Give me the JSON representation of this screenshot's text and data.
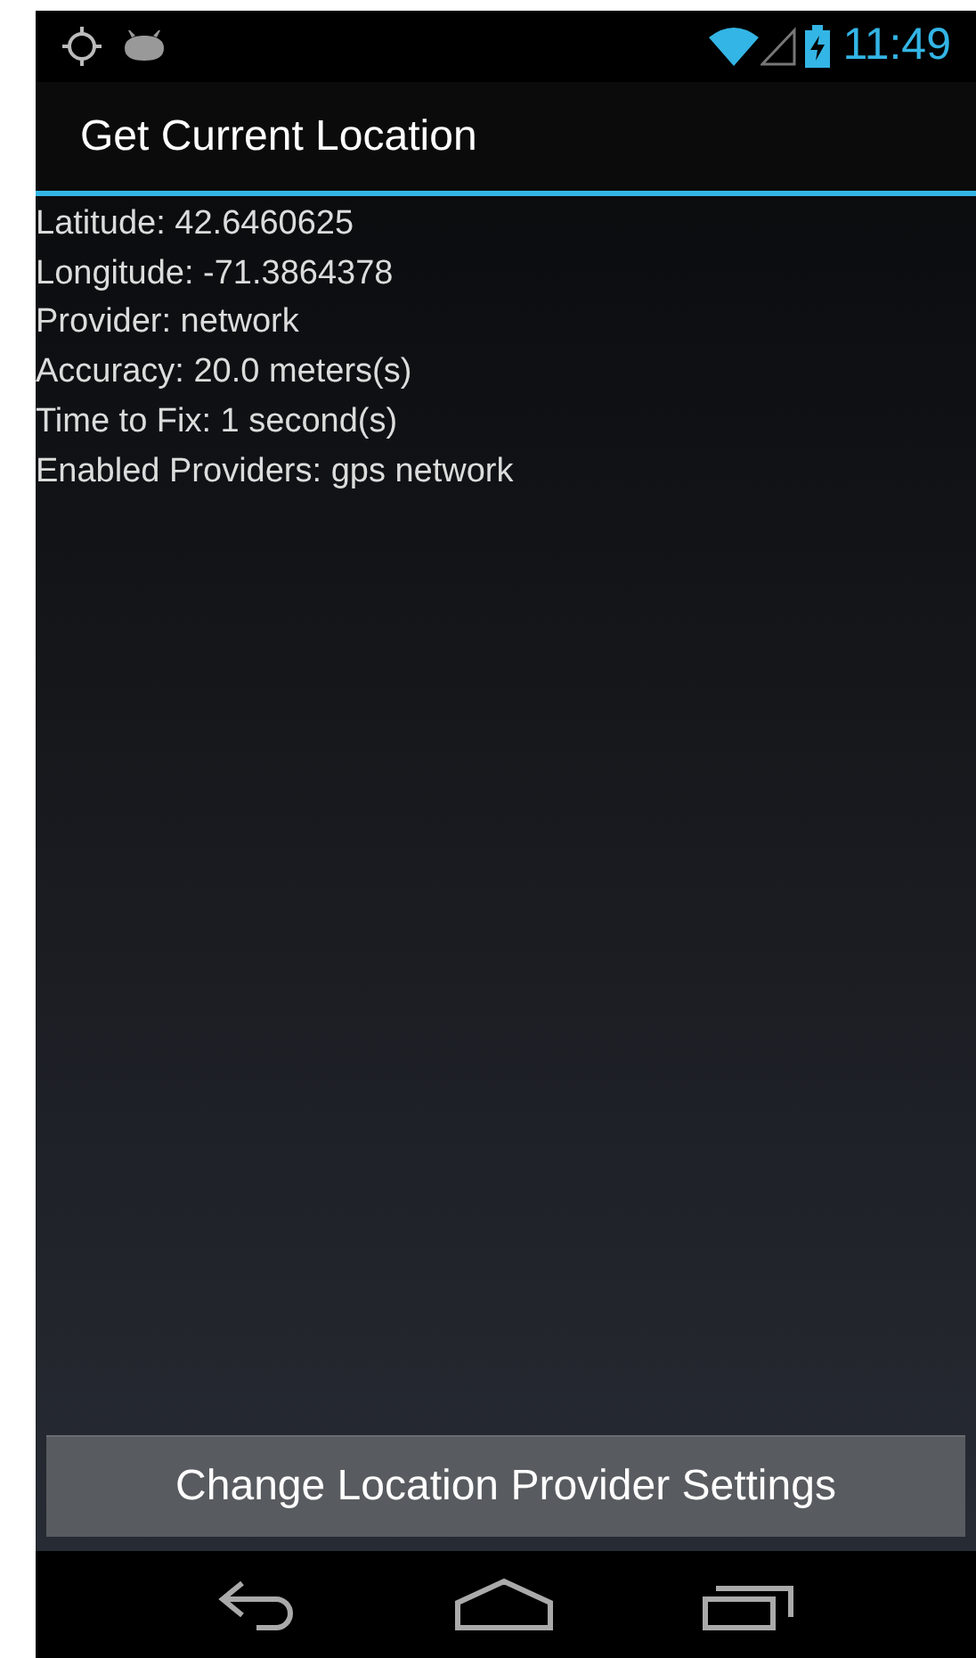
{
  "status_bar": {
    "time": "11:49"
  },
  "action_bar": {
    "title": "Get Current Location"
  },
  "info_lines": [
    "Latitude: 42.6460625",
    "Longitude: -71.3864378",
    "Provider: network",
    "Accuracy: 20.0 meters(s)",
    "Time to Fix: 1 second(s)",
    "Enabled Providers: gps network"
  ],
  "button": {
    "label": "Change Location Provider Settings"
  }
}
